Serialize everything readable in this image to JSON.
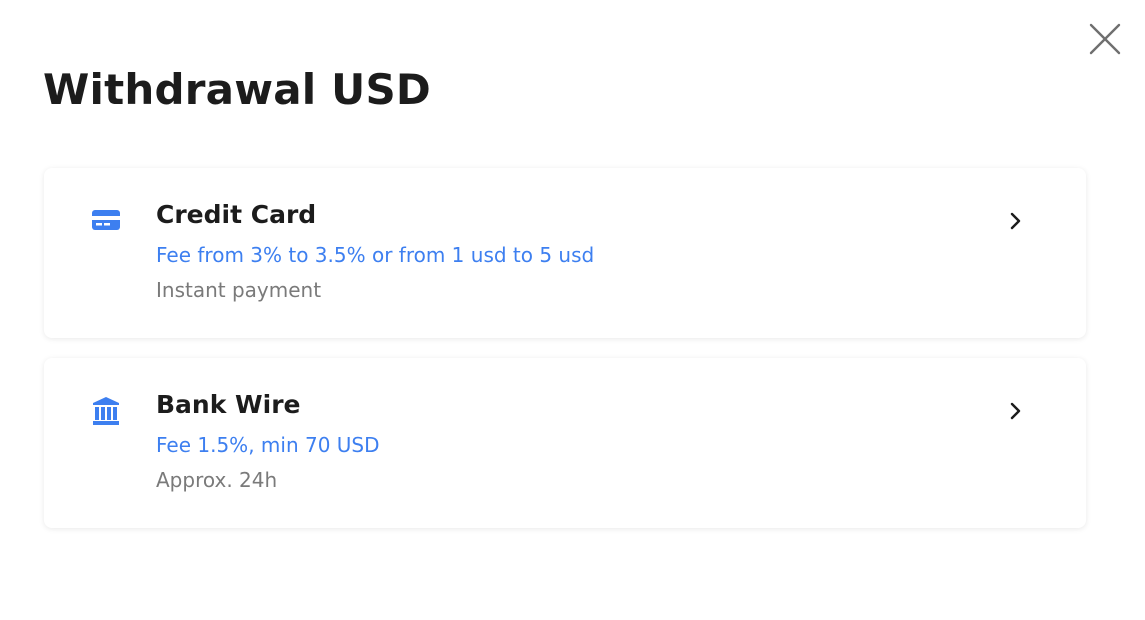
{
  "modal": {
    "title": "Withdrawal USD",
    "close_icon": "close-icon"
  },
  "methods": [
    {
      "name": "Credit Card",
      "fee": "Fee from 3% to 3.5% or from 1 usd to 5 usd",
      "time": "Instant payment",
      "icon": "credit-card-icon"
    },
    {
      "name": "Bank Wire",
      "fee": "Fee 1.5%, min 70 USD",
      "time": "Approx. 24h",
      "icon": "bank-icon"
    }
  ],
  "colors": {
    "accent": "#3d7ff0",
    "title": "#1c1c1c",
    "muted": "#7a7a7a",
    "close": "#6f6f6f"
  }
}
